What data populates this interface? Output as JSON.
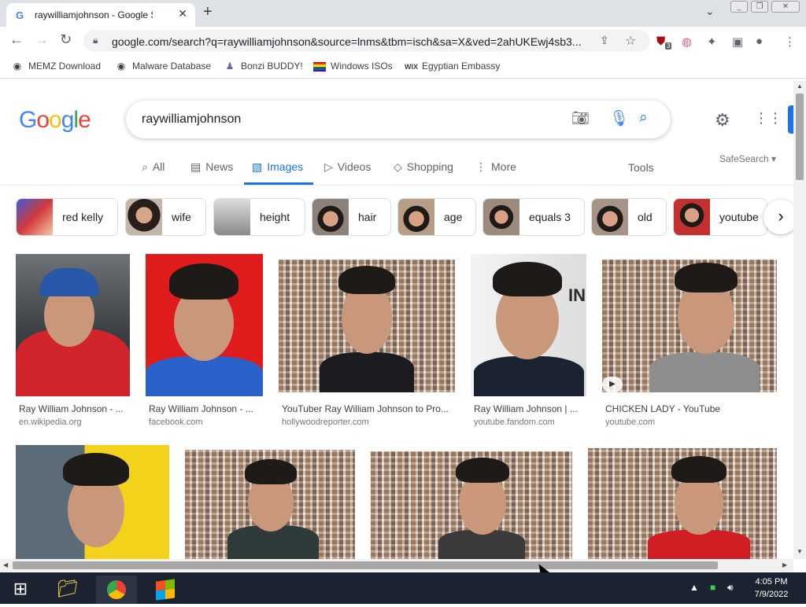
{
  "browser": {
    "tab_title": "raywilliamjohnson - Google Search",
    "tab_favicon": "G",
    "url": "google.com/search?q=raywilliamjohnson&source=lnms&tbm=isch&sa=X&ved=2ahUKEwj4sb3...",
    "extension_badge": "3"
  },
  "bookmarks": [
    {
      "label": "MEMZ Download",
      "icon": "globe-icon"
    },
    {
      "label": "Malware Database",
      "icon": "globe-icon"
    },
    {
      "label": "Bonzi BUDDY!",
      "icon": "bonzi-icon"
    },
    {
      "label": "Windows ISOs",
      "icon": "rainbow-flag-icon"
    },
    {
      "label": "Egyptian Embassy",
      "icon": "wix-icon"
    }
  ],
  "google": {
    "logo": "Google",
    "query": "raywilliamjohnson"
  },
  "search_tabs": [
    {
      "label": "All",
      "icon": "search-icon"
    },
    {
      "label": "News",
      "icon": "news-icon"
    },
    {
      "label": "Images",
      "icon": "image-icon",
      "active": true
    },
    {
      "label": "Videos",
      "icon": "video-icon"
    },
    {
      "label": "Shopping",
      "icon": "tag-icon"
    },
    {
      "label": "More",
      "icon": "more-vert-icon"
    }
  ],
  "tools_label": "Tools",
  "safesearch_label": "SafeSearch",
  "chips": [
    "red kelly",
    "wife",
    "height",
    "hair",
    "age",
    "equals 3",
    "old",
    "youtube"
  ],
  "results_row1": [
    {
      "caption": "Ray William Johnson - ...",
      "source": "en.wikipedia.org"
    },
    {
      "caption": "Ray William Johnson - ...",
      "source": "facebook.com"
    },
    {
      "caption": "YouTuber Ray William Johnson to Pro...",
      "source": "hollywoodreporter.com"
    },
    {
      "caption": "Ray William Johnson | ...",
      "source": "youtube.fandom.com"
    },
    {
      "caption": "CHICKEN LADY - YouTube",
      "source": "youtube.com"
    }
  ],
  "results_row2": [
    {
      "caption": ""
    },
    {
      "caption": ""
    },
    {
      "caption": ""
    },
    {
      "caption": ""
    }
  ],
  "taskbar": {
    "time": "4:05 PM",
    "date": "7/9/2022"
  },
  "colors": {
    "accent": "#1a73e8",
    "taskbar": "#1c2230",
    "tabstrip": "#dee1e6"
  }
}
